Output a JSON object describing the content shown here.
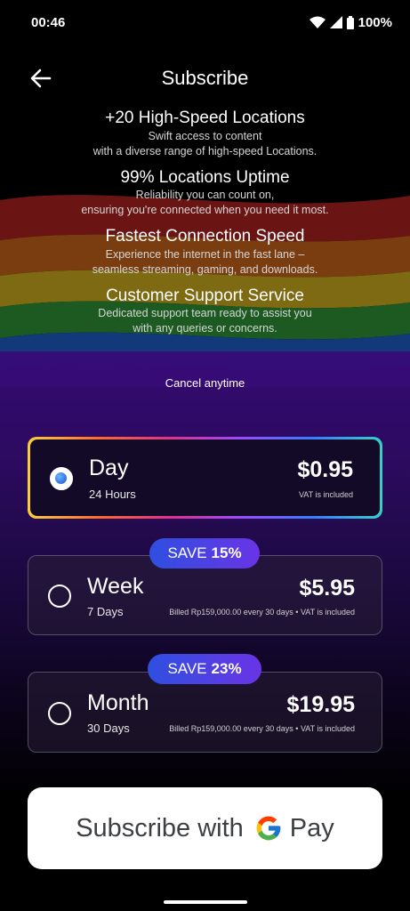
{
  "status_bar": {
    "time": "00:46",
    "battery": "100%"
  },
  "header": {
    "title": "Subscribe"
  },
  "features": [
    {
      "title": "+20 High-Speed Locations",
      "line1": "Swift access to content",
      "line2": "with a diverse range of high-speed Locations."
    },
    {
      "title": "99% Locations Uptime",
      "line1": "Reliability you can count on,",
      "line2": "ensuring you're connected when you need it most."
    },
    {
      "title": "Fastest Connection Speed",
      "line1": "Experience the internet in the fast lane –",
      "line2": "seamless streaming, gaming, and downloads."
    },
    {
      "title": "Customer Support Service",
      "line1": "Dedicated support team ready to assist you",
      "line2": "with any queries or concerns."
    }
  ],
  "cancel_text": "Cancel anytime",
  "plans": [
    {
      "name": "Day",
      "duration": "24 Hours",
      "price": "$0.95",
      "note": "VAT is included",
      "selected": true
    },
    {
      "name": "Week",
      "duration": "7 Days",
      "price": "$5.95",
      "note": "Billed Rp159,000.00 every 30 days  •  VAT is included",
      "selected": false,
      "save_label": "SAVE",
      "save_pct": "15%"
    },
    {
      "name": "Month",
      "duration": "30 Days",
      "price": "$19.95",
      "note": "Billed Rp159,000.00 every 30 days  •  VAT is included",
      "selected": false,
      "save_label": "SAVE",
      "save_pct": "23%"
    }
  ],
  "pay_button": {
    "prefix": "Subscribe with",
    "brand": "Pay"
  },
  "colors": {
    "accent_badge_start": "#2f4fe0",
    "accent_badge_end": "#6a34e6",
    "background": "#000000"
  },
  "icons": [
    "back-arrow-icon",
    "wifi-icon",
    "signal-icon",
    "battery-icon",
    "google-g-icon",
    "radio-selected-icon"
  ]
}
